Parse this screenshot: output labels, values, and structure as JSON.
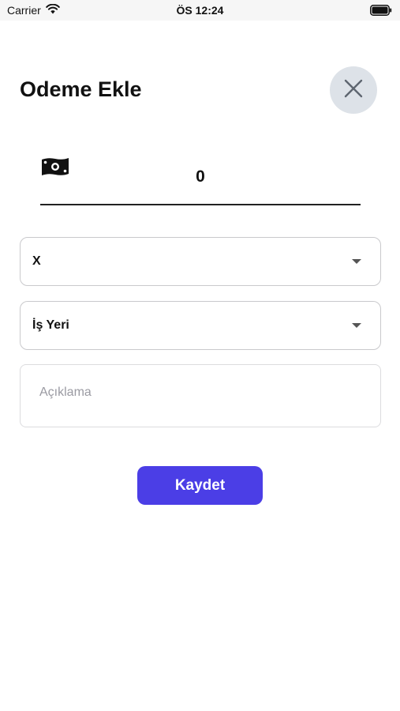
{
  "status_bar": {
    "carrier": "Carrier",
    "time": "ÖS 12:24",
    "wifi_icon": "wifi-icon",
    "battery_icon": "battery-icon"
  },
  "modal": {
    "title": "Odeme Ekle",
    "close_icon": "close-icon",
    "amount": {
      "icon": "money-icon",
      "value": "0"
    },
    "select_person": {
      "value": "X"
    },
    "select_category": {
      "value": "İş Yeri"
    },
    "description": {
      "placeholder": "Açıklama"
    },
    "save_label": "Kaydet"
  },
  "colors": {
    "primary": "#4b3ee6",
    "close_bg": "#dde2e8",
    "border": "#c9c9cc"
  }
}
